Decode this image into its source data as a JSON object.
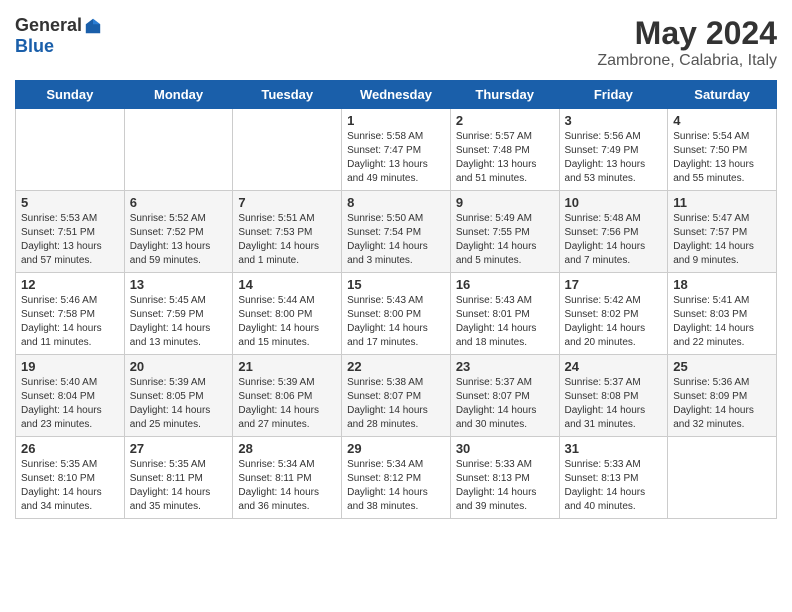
{
  "logo": {
    "general": "General",
    "blue": "Blue"
  },
  "title": "May 2024",
  "location": "Zambrone, Calabria, Italy",
  "weekdays": [
    "Sunday",
    "Monday",
    "Tuesday",
    "Wednesday",
    "Thursday",
    "Friday",
    "Saturday"
  ],
  "weeks": [
    [
      {
        "day": "",
        "info": ""
      },
      {
        "day": "",
        "info": ""
      },
      {
        "day": "",
        "info": ""
      },
      {
        "day": "1",
        "info": "Sunrise: 5:58 AM\nSunset: 7:47 PM\nDaylight: 13 hours\nand 49 minutes."
      },
      {
        "day": "2",
        "info": "Sunrise: 5:57 AM\nSunset: 7:48 PM\nDaylight: 13 hours\nand 51 minutes."
      },
      {
        "day": "3",
        "info": "Sunrise: 5:56 AM\nSunset: 7:49 PM\nDaylight: 13 hours\nand 53 minutes."
      },
      {
        "day": "4",
        "info": "Sunrise: 5:54 AM\nSunset: 7:50 PM\nDaylight: 13 hours\nand 55 minutes."
      }
    ],
    [
      {
        "day": "5",
        "info": "Sunrise: 5:53 AM\nSunset: 7:51 PM\nDaylight: 13 hours\nand 57 minutes."
      },
      {
        "day": "6",
        "info": "Sunrise: 5:52 AM\nSunset: 7:52 PM\nDaylight: 13 hours\nand 59 minutes."
      },
      {
        "day": "7",
        "info": "Sunrise: 5:51 AM\nSunset: 7:53 PM\nDaylight: 14 hours\nand 1 minute."
      },
      {
        "day": "8",
        "info": "Sunrise: 5:50 AM\nSunset: 7:54 PM\nDaylight: 14 hours\nand 3 minutes."
      },
      {
        "day": "9",
        "info": "Sunrise: 5:49 AM\nSunset: 7:55 PM\nDaylight: 14 hours\nand 5 minutes."
      },
      {
        "day": "10",
        "info": "Sunrise: 5:48 AM\nSunset: 7:56 PM\nDaylight: 14 hours\nand 7 minutes."
      },
      {
        "day": "11",
        "info": "Sunrise: 5:47 AM\nSunset: 7:57 PM\nDaylight: 14 hours\nand 9 minutes."
      }
    ],
    [
      {
        "day": "12",
        "info": "Sunrise: 5:46 AM\nSunset: 7:58 PM\nDaylight: 14 hours\nand 11 minutes."
      },
      {
        "day": "13",
        "info": "Sunrise: 5:45 AM\nSunset: 7:59 PM\nDaylight: 14 hours\nand 13 minutes."
      },
      {
        "day": "14",
        "info": "Sunrise: 5:44 AM\nSunset: 8:00 PM\nDaylight: 14 hours\nand 15 minutes."
      },
      {
        "day": "15",
        "info": "Sunrise: 5:43 AM\nSunset: 8:00 PM\nDaylight: 14 hours\nand 17 minutes."
      },
      {
        "day": "16",
        "info": "Sunrise: 5:43 AM\nSunset: 8:01 PM\nDaylight: 14 hours\nand 18 minutes."
      },
      {
        "day": "17",
        "info": "Sunrise: 5:42 AM\nSunset: 8:02 PM\nDaylight: 14 hours\nand 20 minutes."
      },
      {
        "day": "18",
        "info": "Sunrise: 5:41 AM\nSunset: 8:03 PM\nDaylight: 14 hours\nand 22 minutes."
      }
    ],
    [
      {
        "day": "19",
        "info": "Sunrise: 5:40 AM\nSunset: 8:04 PM\nDaylight: 14 hours\nand 23 minutes."
      },
      {
        "day": "20",
        "info": "Sunrise: 5:39 AM\nSunset: 8:05 PM\nDaylight: 14 hours\nand 25 minutes."
      },
      {
        "day": "21",
        "info": "Sunrise: 5:39 AM\nSunset: 8:06 PM\nDaylight: 14 hours\nand 27 minutes."
      },
      {
        "day": "22",
        "info": "Sunrise: 5:38 AM\nSunset: 8:07 PM\nDaylight: 14 hours\nand 28 minutes."
      },
      {
        "day": "23",
        "info": "Sunrise: 5:37 AM\nSunset: 8:07 PM\nDaylight: 14 hours\nand 30 minutes."
      },
      {
        "day": "24",
        "info": "Sunrise: 5:37 AM\nSunset: 8:08 PM\nDaylight: 14 hours\nand 31 minutes."
      },
      {
        "day": "25",
        "info": "Sunrise: 5:36 AM\nSunset: 8:09 PM\nDaylight: 14 hours\nand 32 minutes."
      }
    ],
    [
      {
        "day": "26",
        "info": "Sunrise: 5:35 AM\nSunset: 8:10 PM\nDaylight: 14 hours\nand 34 minutes."
      },
      {
        "day": "27",
        "info": "Sunrise: 5:35 AM\nSunset: 8:11 PM\nDaylight: 14 hours\nand 35 minutes."
      },
      {
        "day": "28",
        "info": "Sunrise: 5:34 AM\nSunset: 8:11 PM\nDaylight: 14 hours\nand 36 minutes."
      },
      {
        "day": "29",
        "info": "Sunrise: 5:34 AM\nSunset: 8:12 PM\nDaylight: 14 hours\nand 38 minutes."
      },
      {
        "day": "30",
        "info": "Sunrise: 5:33 AM\nSunset: 8:13 PM\nDaylight: 14 hours\nand 39 minutes."
      },
      {
        "day": "31",
        "info": "Sunrise: 5:33 AM\nSunset: 8:13 PM\nDaylight: 14 hours\nand 40 minutes."
      },
      {
        "day": "",
        "info": ""
      }
    ]
  ]
}
